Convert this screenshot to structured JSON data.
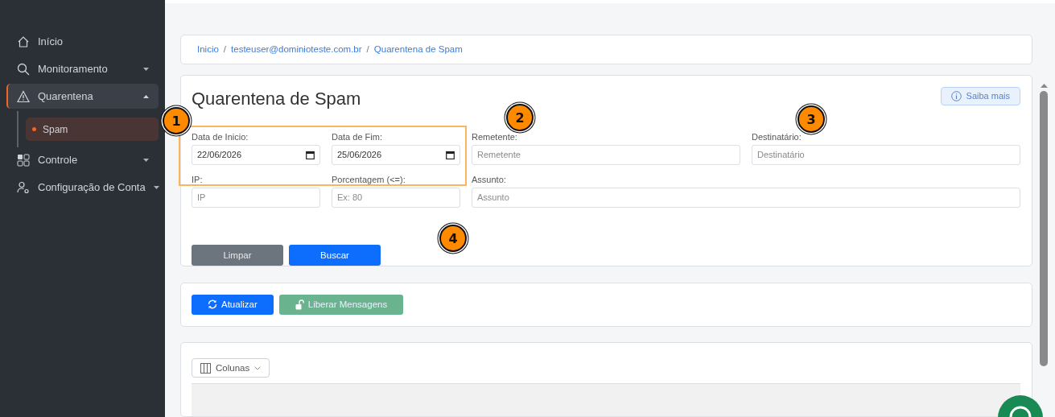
{
  "sidebar": {
    "items": [
      {
        "label": "Início",
        "kind": "link",
        "selected": false
      },
      {
        "label": "Monitoramento",
        "kind": "menu",
        "expanded": false,
        "selected": false
      },
      {
        "label": "Quarentena",
        "kind": "menu",
        "expanded": true,
        "selected": true,
        "children": [
          {
            "label": "Spam",
            "selected": true
          }
        ]
      },
      {
        "label": "Controle",
        "kind": "menu",
        "expanded": false,
        "selected": false
      },
      {
        "label": "Configuração de Conta",
        "kind": "menu",
        "expanded": false,
        "selected": false
      }
    ]
  },
  "breadcrumb": {
    "separator": "/",
    "items": [
      "Inicio",
      "testeuser@dominioteste.com.br",
      "Quarentena de Spam"
    ]
  },
  "filter": {
    "title": "Quarentena de Spam",
    "help_button": "Saiba mais",
    "rows": [
      [
        {
          "kind": "date",
          "label": "Data de Inicio:",
          "value": "22/06/2026"
        },
        {
          "kind": "date",
          "label": "Data de Fim:",
          "value": "25/06/2026"
        },
        {
          "kind": "text",
          "label": "Remetente:",
          "placeholder": "Remetente"
        },
        {
          "kind": "text",
          "label": "Destinatário:",
          "placeholder": "Destinatário"
        }
      ],
      [
        {
          "kind": "text",
          "label": "IP:",
          "placeholder": "IP"
        },
        {
          "kind": "text",
          "label": "Porcentagem (<=):",
          "placeholder": "Ex: 80"
        },
        {
          "kind": "text",
          "label": "Assunto:",
          "placeholder": "Assunto"
        }
      ]
    ],
    "buttons": [
      {
        "label": "Limpar",
        "kind": "secondary"
      },
      {
        "label": "Buscar",
        "kind": "primary"
      }
    ]
  },
  "actions": [
    {
      "label": "Atualizar",
      "kind": "refresh",
      "disabled": false
    },
    {
      "label": "Liberar Mensagens",
      "kind": "release",
      "disabled": true
    }
  ],
  "table": {
    "columns_button": "Colunas"
  },
  "annotations": [
    {
      "number": "1"
    },
    {
      "number": "2"
    },
    {
      "number": "3"
    },
    {
      "number": "4"
    }
  ]
}
